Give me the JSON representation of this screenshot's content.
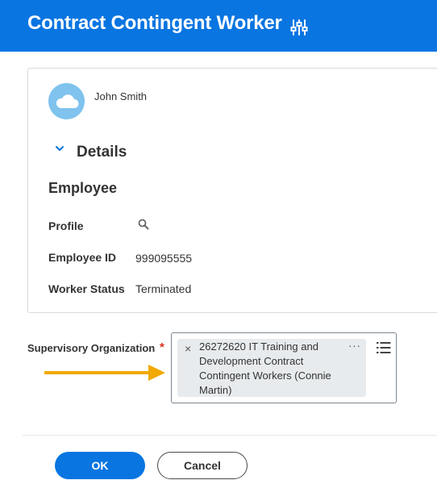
{
  "header": {
    "title": "Contract Contingent Worker",
    "related_actions_icon": "sliders-icon"
  },
  "worker": {
    "name": "John Smith",
    "avatar_icon": "cloud-icon"
  },
  "details": {
    "section_title": "Details",
    "subsection_title": "Employee",
    "fields": [
      {
        "label": "Profile",
        "value": "",
        "icon": "search-icon"
      },
      {
        "label": "Employee ID",
        "value": "999095555"
      },
      {
        "label": "Worker Status",
        "value": "Terminated"
      }
    ]
  },
  "supervisory_org": {
    "label": "Supervisory Organization",
    "required_mark": "*",
    "selected": {
      "remove_glyph": "×",
      "lines": [
        "26272620 IT Training and",
        "Development Contract",
        "Contingent Workers (Connie",
        "Martin)"
      ],
      "more_glyph": "···"
    },
    "list_icon": "list-icon"
  },
  "actions": {
    "ok_label": "OK",
    "cancel_label": "Cancel"
  },
  "colors": {
    "brand_blue": "#0875e1",
    "avatar_blue": "#7fc3ee",
    "required_red": "#de2e21",
    "arrow_orange": "#f2a900"
  }
}
